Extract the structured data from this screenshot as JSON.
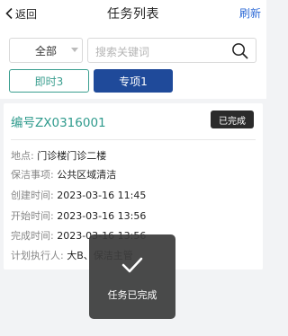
{
  "navbar": {
    "back_label": "返回",
    "title": "任务列表",
    "refresh_label": "刷新"
  },
  "filter": {
    "dropdown_value": "全部",
    "search_placeholder": "搜索关键词",
    "immediate_label": "即时3",
    "special_label": "专项1"
  },
  "task": {
    "number": "编号ZX0316001",
    "status": "已完成",
    "fields": [
      {
        "label": "地点:",
        "value": "门诊楼门诊二楼"
      },
      {
        "label": "保洁事项:",
        "value": "公共区域清洁"
      },
      {
        "label": "创建时间:",
        "value": "2023-03-16 11:45"
      },
      {
        "label": "开始时间:",
        "value": "2023-03-16 13:56"
      },
      {
        "label": "完成时间:",
        "value": "2023-03-16 13:56"
      },
      {
        "label": "计划执行人:",
        "value": "大B、保洁主管"
      }
    ]
  },
  "toast": {
    "icon": "check-icon",
    "text": "任务已完成"
  },
  "colors": {
    "accent_teal": "#2e9a8c",
    "primary_blue": "#1f4a9a",
    "link_blue": "#2f6bd6",
    "badge_dark": "#2b2b2b"
  }
}
